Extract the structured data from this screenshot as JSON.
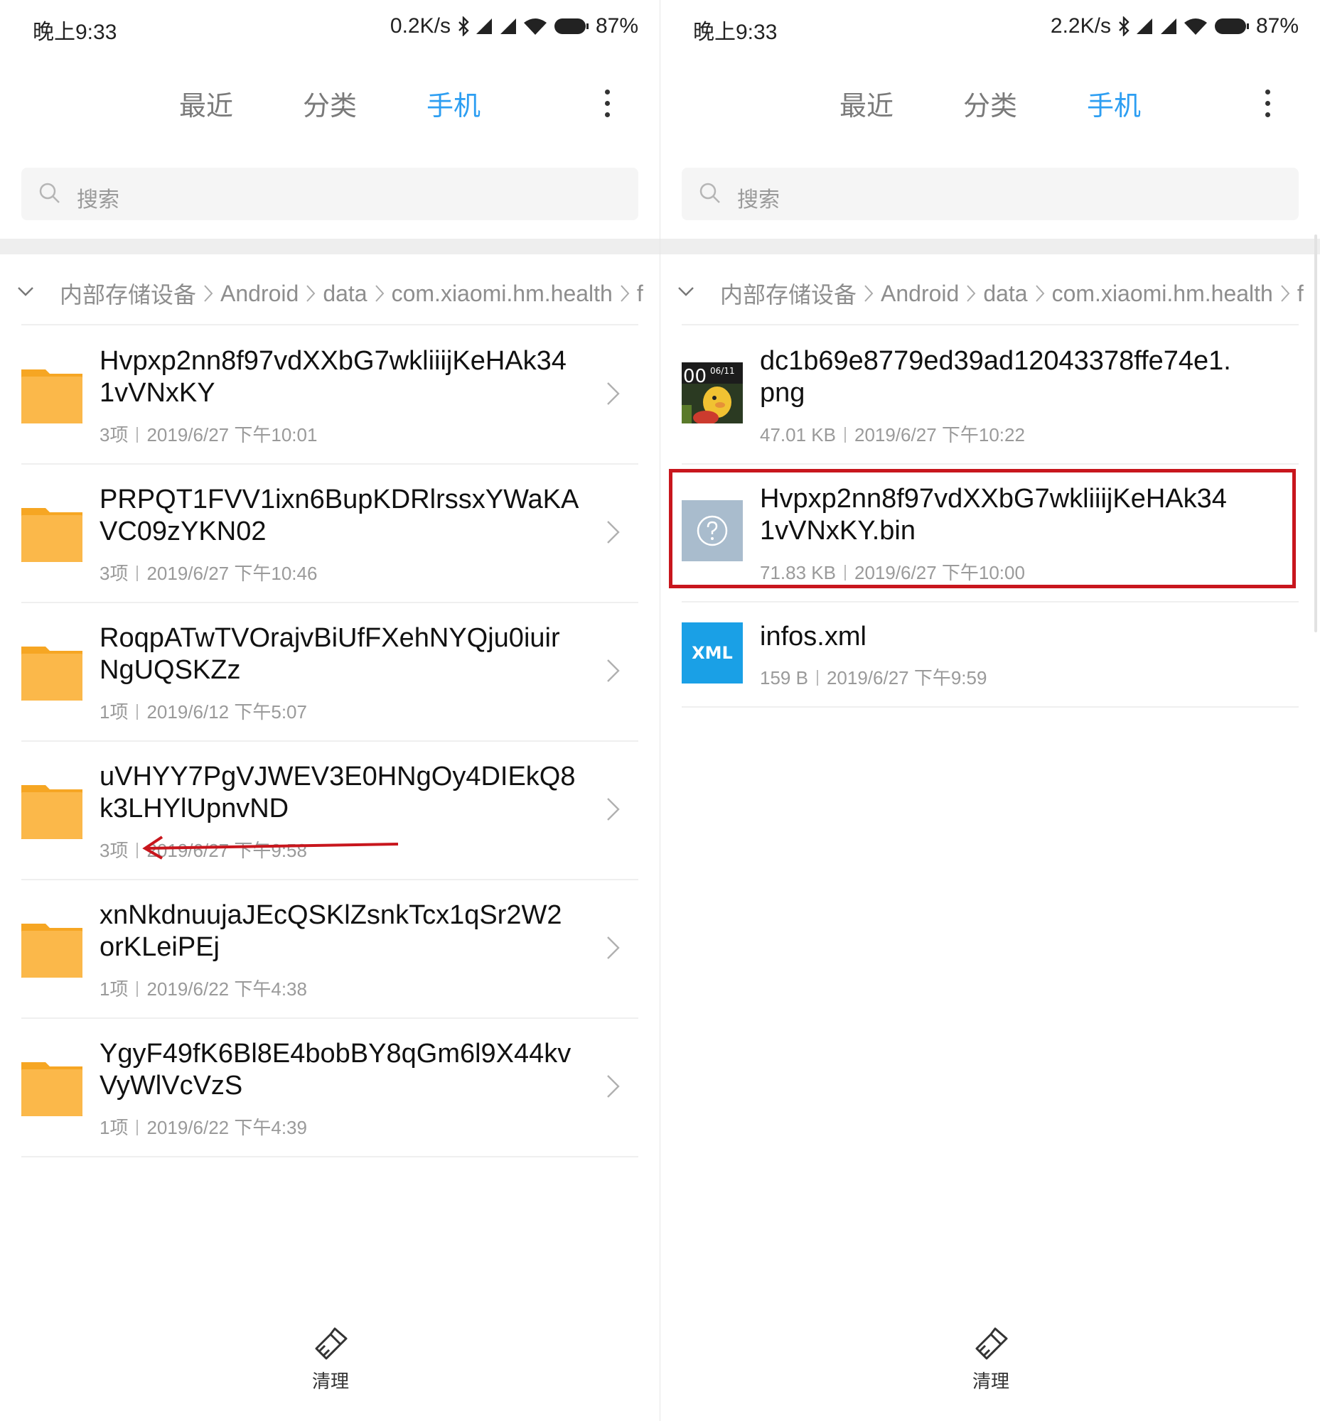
{
  "panels": [
    {
      "status": {
        "time": "晚上9:33",
        "speed": "0.2K/s",
        "battery": "87%"
      },
      "tabs": [
        "最近",
        "分类",
        "手机"
      ],
      "active_tab": 2,
      "search": {
        "placeholder": "搜索"
      },
      "breadcrumb": [
        "内部存储设备",
        "Android",
        "data",
        "com.xiaomi.hm.health",
        "f"
      ],
      "rows": [
        {
          "title": "Hvpxp2nn8f97vdXXbG7wkliiijKeHAk34\n1vVNxKY",
          "count": "3项",
          "date": "2019/6/27 下午10:01"
        },
        {
          "title": "PRPQT1FVV1ixn6BupKDRlrssxYWaKA\nVC09zYKN02",
          "count": "3项",
          "date": "2019/6/27 下午10:46"
        },
        {
          "title": "RoqpATwTVOrajvBiUfFXehNYQju0iuir\nNgUQSKZz",
          "count": "1项",
          "date": "2019/6/12 下午5:07"
        },
        {
          "title": "uVHYY7PgVJWEV3E0HNgOy4DIEkQ8\nk3LHYlUpnvND",
          "count": "3项",
          "date": "2019/6/27 下午9:58"
        },
        {
          "title": "xnNkdnuujaJEcQSKlZsnkTcx1qSr2W2\norKLeiPEj",
          "count": "1项",
          "date": "2019/6/22 下午4:38"
        },
        {
          "title": "YgyF49fK6Bl8E4bobBY8qGm6l9X44kv\nVyWlVcVzS",
          "count": "1项",
          "date": "2019/6/22 下午4:39"
        }
      ],
      "clean_label": "清理"
    },
    {
      "status": {
        "time": "晚上9:33",
        "speed": "2.2K/s",
        "battery": "87%"
      },
      "tabs": [
        "最近",
        "分类",
        "手机"
      ],
      "active_tab": 2,
      "search": {
        "placeholder": "搜索"
      },
      "breadcrumb": [
        "内部存储设备",
        "Android",
        "data",
        "com.xiaomi.hm.health",
        "f"
      ],
      "files": [
        {
          "title": "dc1b69e8779ed39ad12043378ffe74e1.\npng",
          "size": "47.01 KB",
          "date": "2019/6/27 下午10:22",
          "icon": "image-thumbnail",
          "thumb_text": "00",
          "thumb_date": "06/11"
        },
        {
          "title": "Hvpxp2nn8f97vdXXbG7wkliiijKeHAk34\n1vVNxKY.bin",
          "size": "71.83 KB",
          "date": "2019/6/27 下午10:00",
          "icon": "unknown-file-icon",
          "highlighted": true
        },
        {
          "title": "infos.xml",
          "size": "159 B",
          "date": "2019/6/27 下午9:59",
          "icon": "xml-file-icon",
          "icon_text": "XML"
        }
      ],
      "clean_label": "清理"
    }
  ],
  "colors": {
    "accent": "#2d9ef2",
    "folder": "#fbb84a",
    "annotation": "#c8161d",
    "xml": "#1aa0e6",
    "unknown": "#a9bccd"
  }
}
